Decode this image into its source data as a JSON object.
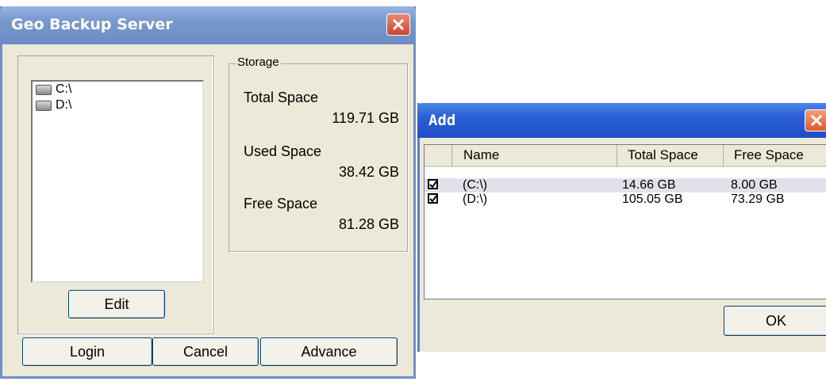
{
  "geo_window": {
    "title": "Geo Backup Server",
    "drives": [
      {
        "label": "C:\\"
      },
      {
        "label": "D:\\"
      }
    ],
    "edit_label": "Edit",
    "storage": {
      "legend": "Storage",
      "total_label": "Total Space",
      "total_value": "119.71 GB",
      "used_label": "Used Space",
      "used_value": "38.42 GB",
      "free_label": "Free Space",
      "free_value": "81.28 GB"
    },
    "buttons": {
      "login": "Login",
      "cancel": "Cancel",
      "advance": "Advance"
    }
  },
  "add_window": {
    "title": "Add",
    "columns": [
      "Name",
      "Total Space",
      "Free Space"
    ],
    "rows": [
      {
        "checked": true,
        "name": "(C:\\)",
        "total": "14.66 GB",
        "free": "8.00 GB"
      },
      {
        "checked": true,
        "name": "(D:\\)",
        "total": "105.05 GB",
        "free": "73.29 GB"
      }
    ],
    "ok_label": "OK"
  },
  "colors": {
    "window_bg": "#ece9d8",
    "geo_titlebar": "#7898cc",
    "add_titlebar": "#2a5fd6",
    "close_red": "#c9472c"
  }
}
